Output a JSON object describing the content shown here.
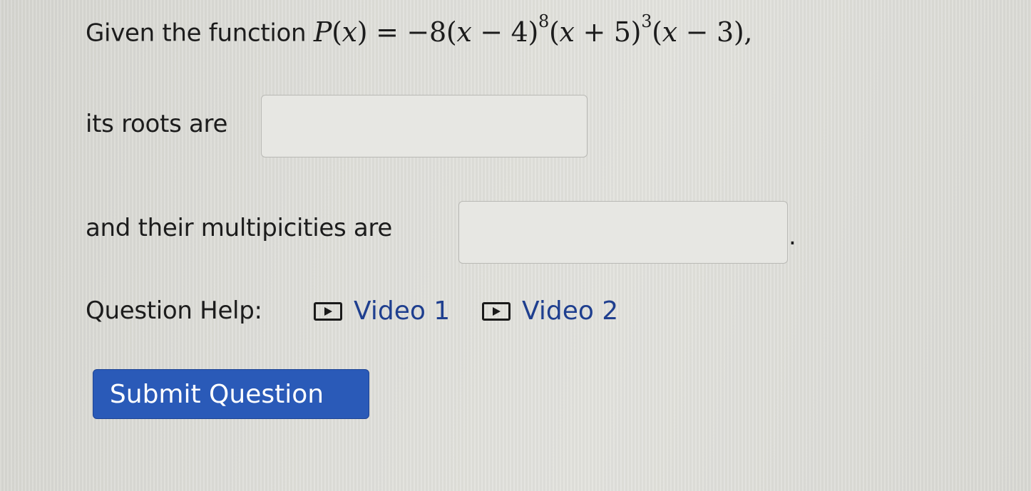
{
  "question": {
    "intro": "Given the function",
    "function_name": "P",
    "variable": "x",
    "equals": "=",
    "coefficient": "−8",
    "factor1_open": "(",
    "factor1_op": " − 4)",
    "factor1_exp": "8",
    "factor2_open": "(",
    "factor2_op": " + 5)",
    "factor2_exp": "3",
    "factor3_open": "(",
    "factor3_op": " − 3),"
  },
  "roots": {
    "label": "its roots are",
    "value": ""
  },
  "multiplicities": {
    "label": "and their multipicities are",
    "value": "",
    "period": "."
  },
  "help": {
    "label": "Question Help:",
    "links": [
      {
        "label": "Video 1",
        "icon": "play-icon"
      },
      {
        "label": "Video 2",
        "icon": "play-icon"
      }
    ]
  },
  "submit": {
    "label": "Submit Question",
    "color": "#2a5ab8"
  }
}
